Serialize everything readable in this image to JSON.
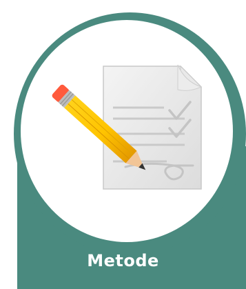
{
  "card": {
    "label": "Metode",
    "accent_color": "#4a8a7f",
    "icon": "document-pencil-icon"
  }
}
